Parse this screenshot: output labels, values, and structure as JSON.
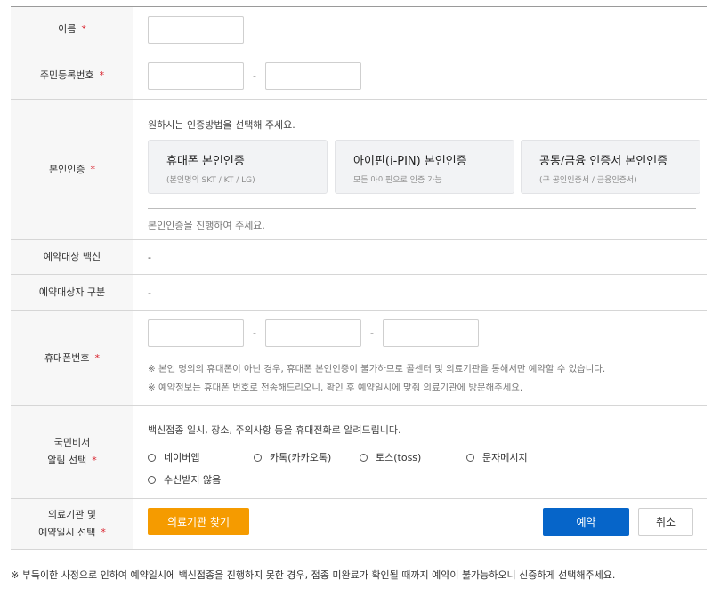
{
  "form": {
    "required_mark": "*",
    "name": {
      "label": "이름"
    },
    "resident_number": {
      "label": "주민등록번호",
      "separator": "-"
    },
    "identity": {
      "label": "본인인증",
      "guide": "원하시는 인증방법을 선택해 주세요.",
      "methods": [
        {
          "title": "휴대폰 본인인증",
          "subtitle": "(본인명의 SKT / KT / LG)"
        },
        {
          "title": "아이핀(i-PIN) 본인인증",
          "subtitle": "모든 아이핀으로 인증 가능"
        },
        {
          "title": "공동/금융 인증서 본인인증",
          "subtitle": "(구 공인인증서 / 금융인증서)"
        }
      ],
      "status": "본인인증을 진행하여 주세요."
    },
    "vaccine": {
      "label": "예약대상 백신",
      "value": "-"
    },
    "target_type": {
      "label": "예약대상자 구분",
      "value": "-"
    },
    "phone": {
      "label": "휴대폰번호",
      "separator": "-",
      "notes": [
        "※ 본인 명의의 휴대폰이 아닌 경우, 휴대폰 본인인증이 불가하므로 콜센터 및 의료기관을 통해서만 예약할 수 있습니다.",
        "※ 예약정보는 휴대폰 번호로 전송해드리오니, 확인 후 예약일시에 맞춰 의료기관에 방문해주세요."
      ]
    },
    "notification": {
      "label_line1": "국민비서",
      "label_line2": "알림 선택",
      "guide": "백신접종 일시, 장소, 주의사항 등을 휴대전화로 알려드립니다.",
      "options": [
        "네이버앱",
        "카톡(카카오톡)",
        "토스(toss)",
        "문자메시지",
        "수신받지 않음"
      ]
    },
    "institution": {
      "label_line1": "의료기관 및",
      "label_line2": "예약일시 선택",
      "find_button": "의료기관 찾기",
      "reserve_button": "예약",
      "cancel_button": "취소"
    }
  },
  "footnote": "※ 부득이한 사정으로 인하여 예약일시에 백신접종을 진행하지 못한 경우, 접종 미완료가 확인될 때까지 예약이 불가능하오니 신중하게 선택해주세요."
}
